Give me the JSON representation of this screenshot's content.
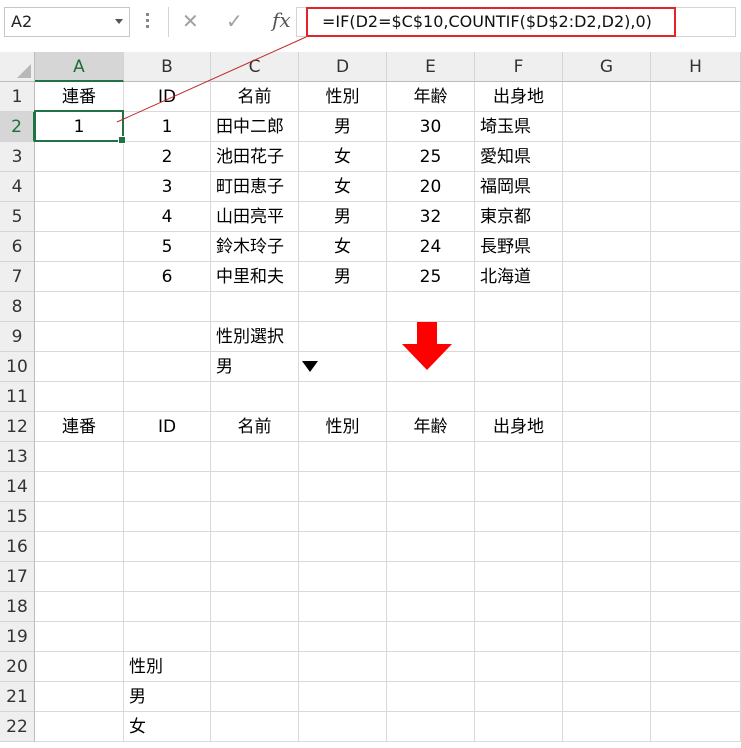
{
  "name_box": "A2",
  "formula": "=IF(D2=$C$10,COUNTIF($D$2:D2,D2),0)",
  "toolbar": {
    "cancel_icon": "✕",
    "enter_icon": "✓",
    "fx_label": "fx"
  },
  "columns": [
    "A",
    "B",
    "C",
    "D",
    "E",
    "F",
    "G",
    "H"
  ],
  "rows": [
    "1",
    "2",
    "3",
    "4",
    "5",
    "6",
    "7",
    "8",
    "9",
    "10",
    "11",
    "12",
    "13",
    "14",
    "15",
    "16",
    "17",
    "18",
    "19",
    "20",
    "21",
    "22"
  ],
  "header1": [
    "連番",
    "ID",
    "名前",
    "性別",
    "年齢",
    "出身地"
  ],
  "table": [
    {
      "a": "1",
      "id": "1",
      "name": "田中二郎",
      "sex": "男",
      "age": "30",
      "from": "埼玉県"
    },
    {
      "a": "",
      "id": "2",
      "name": "池田花子",
      "sex": "女",
      "age": "25",
      "from": "愛知県"
    },
    {
      "a": "",
      "id": "3",
      "name": "町田恵子",
      "sex": "女",
      "age": "20",
      "from": "福岡県"
    },
    {
      "a": "",
      "id": "4",
      "name": "山田亮平",
      "sex": "男",
      "age": "32",
      "from": "東京都"
    },
    {
      "a": "",
      "id": "5",
      "name": "鈴木玲子",
      "sex": "女",
      "age": "24",
      "from": "長野県"
    },
    {
      "a": "",
      "id": "6",
      "name": "中里和夫",
      "sex": "男",
      "age": "25",
      "from": "北海道"
    }
  ],
  "select_label": "性別選択",
  "select_value": "男",
  "header2": [
    "連番",
    "ID",
    "名前",
    "性別",
    "年齢",
    "出身地"
  ],
  "list_header": "性別",
  "list_items": [
    "男",
    "女"
  ],
  "colors": {
    "selection": "#217346",
    "highlight": "#e0262a",
    "arrow": "#ff0000"
  }
}
